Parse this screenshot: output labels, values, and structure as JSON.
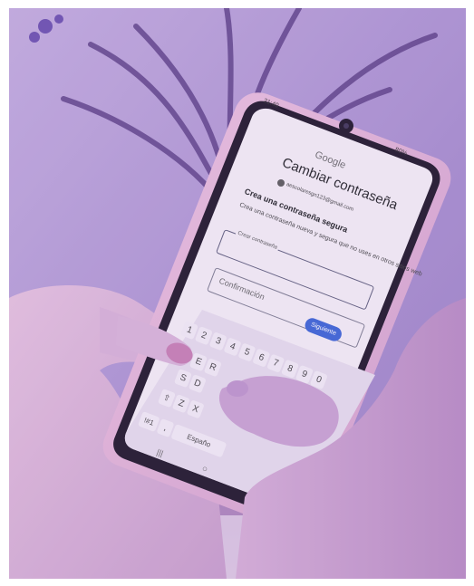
{
  "phone": {
    "status_time": "21:40",
    "battery": "80%",
    "brand": "Google",
    "title": "Cambiar contraseña",
    "account_email": "aescolaresgn123@gmail.com",
    "heading": "Crea una contraseña segura",
    "description": "Crea una contraseña nueva y segura que no uses en otros sitios web",
    "field_new_label": "Crear contraseña",
    "field_confirm_placeholder": "Confirmación",
    "next_button": "Siguiente",
    "keyboard": {
      "number_row": [
        "1",
        "2",
        "3",
        "4",
        "5",
        "6",
        "7",
        "8",
        "9",
        "0"
      ],
      "row_2": [
        "E",
        "R"
      ],
      "row_3": [
        "S",
        "D"
      ],
      "row_4": [
        "Z",
        "X"
      ],
      "symbols_key": "!#1",
      "comma_key": ",",
      "space_key": "Españo"
    }
  },
  "colors": {
    "tint": "#a98fd0",
    "phone_case": "#e3b5d8",
    "screen_bg": "#f6f1f8",
    "next_button": "#3a63d6",
    "nail_polish": "#c87fb4"
  }
}
